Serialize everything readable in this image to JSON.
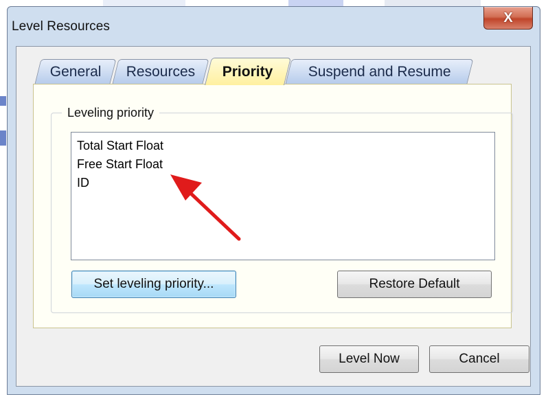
{
  "window": {
    "title": "Level Resources",
    "close_label": "X"
  },
  "tabs": [
    {
      "label": "General",
      "active": false
    },
    {
      "label": "Resources",
      "active": false
    },
    {
      "label": "Priority",
      "active": true
    },
    {
      "label": "Suspend and Resume",
      "active": false
    }
  ],
  "priority_panel": {
    "group_label": "Leveling priority",
    "items": [
      "Total Start Float",
      "Free Start Float",
      "ID"
    ],
    "set_button": "Set leveling priority...",
    "restore_button": "Restore Default"
  },
  "footer": {
    "level_now": "Level Now",
    "cancel": "Cancel"
  },
  "colors": {
    "active_tab": "#fff0a0",
    "inactive_tab": "#b7cceb",
    "arrow": "#e01b1b"
  }
}
